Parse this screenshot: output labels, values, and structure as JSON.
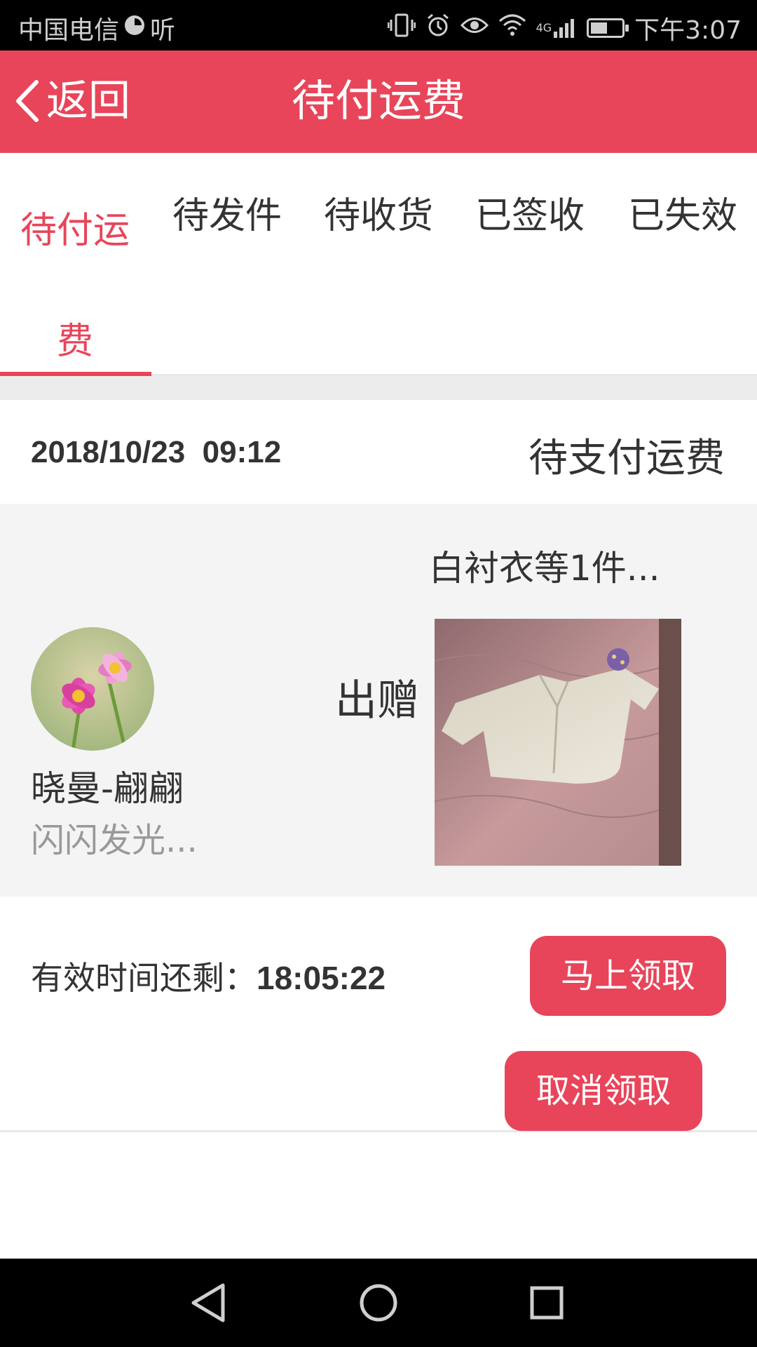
{
  "status_bar": {
    "carrier": "中国电信",
    "listen_label": "听",
    "network": "4G",
    "time": "下午3:07",
    "battery_level": 0.55,
    "icons": [
      "vibrate-icon",
      "alarm-icon",
      "eye-icon",
      "wifi-icon",
      "signal-icon",
      "battery-icon"
    ]
  },
  "header": {
    "back_label": "返回",
    "title": "待付运费"
  },
  "tabs": [
    {
      "label": "待付运费",
      "active": true
    },
    {
      "label": "待发件",
      "active": false
    },
    {
      "label": "待收货",
      "active": false
    },
    {
      "label": "已签收",
      "active": false
    },
    {
      "label": "已失效",
      "active": false
    }
  ],
  "order": {
    "datetime": "2018/10/23  09:12",
    "status": "待支付运费",
    "item_title": "白衬衣等1件...",
    "action_label": "出赠",
    "user_name": "晓曼-翩翩",
    "user_subtitle": "闪闪发光...",
    "countdown_label": "有效时间还剩：",
    "countdown_value": "18:05:22",
    "claim_button": "马上领取",
    "cancel_button": "取消领取"
  },
  "colors": {
    "accent": "#e8455a",
    "background_gray": "#f4f4f4"
  },
  "nav_bar": {
    "icons": [
      "back-triangle-icon",
      "home-circle-icon",
      "recents-square-icon"
    ]
  }
}
